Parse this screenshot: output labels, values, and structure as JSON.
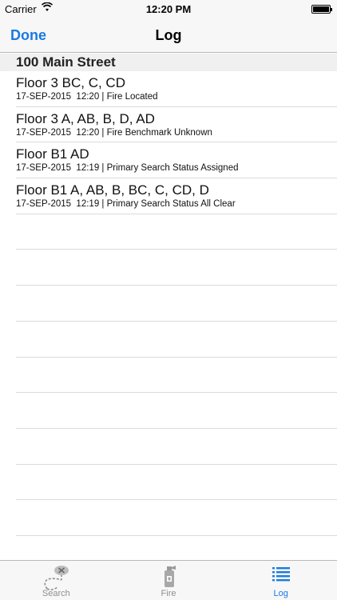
{
  "status_bar": {
    "carrier": "Carrier",
    "time": "12:20 PM"
  },
  "nav": {
    "done_label": "Done",
    "title": "Log"
  },
  "section": {
    "title": "100 Main Street"
  },
  "log_entries": [
    {
      "location": "Floor 3 BC, C, CD",
      "detail": "17-SEP-2015  12:20 | Fire Located"
    },
    {
      "location": "Floor 3 A, AB, B, D, AD",
      "detail": "17-SEP-2015  12:20 | Fire Benchmark Unknown"
    },
    {
      "location": "Floor B1 AD",
      "detail": "17-SEP-2015  12:19 | Primary Search Status Assigned"
    },
    {
      "location": "Floor B1 A, AB, B, BC, C, CD, D",
      "detail": "17-SEP-2015  12:19 | Primary Search Status All Clear"
    }
  ],
  "tabs": {
    "search": "Search",
    "fire": "Fire",
    "log": "Log",
    "active": "log"
  },
  "colors": {
    "accent": "#1a7ae0",
    "inactive": "#8e8e8e"
  }
}
